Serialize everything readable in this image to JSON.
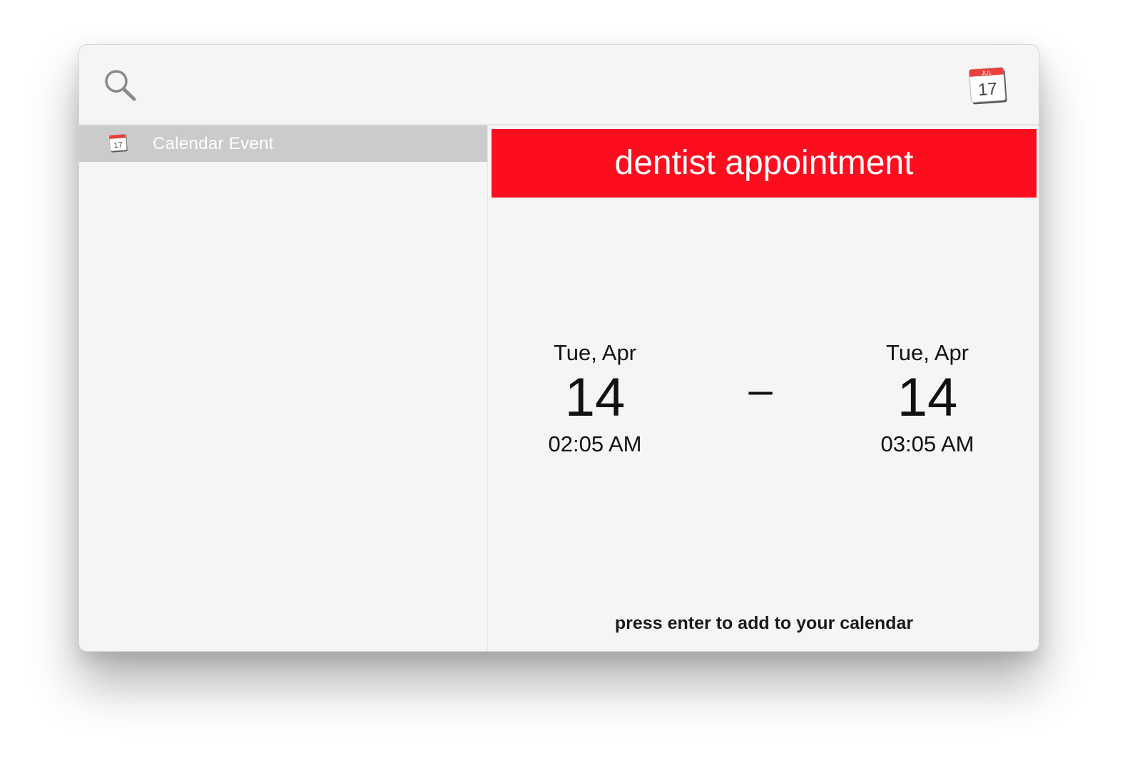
{
  "search": {
    "value": "",
    "placeholder": ""
  },
  "app_icon": {
    "name": "calendar-app-icon",
    "month": "JUL",
    "day": "17"
  },
  "results": [
    {
      "label": "Calendar Event",
      "icon": "calendar-icon",
      "icon_day": "17",
      "selected": true
    }
  ],
  "event": {
    "title": "dentist appointment",
    "start": {
      "weekday_month": "Tue, Apr",
      "day": "14",
      "time": "02:05 AM"
    },
    "separator": "–",
    "end": {
      "weekday_month": "Tue, Apr",
      "day": "14",
      "time": "03:05 AM"
    },
    "hint": "press enter to add to your calendar"
  },
  "colors": {
    "banner": "#fc0e1f",
    "selected_row": "#cbcbcb",
    "background": "#f5f5f5"
  }
}
